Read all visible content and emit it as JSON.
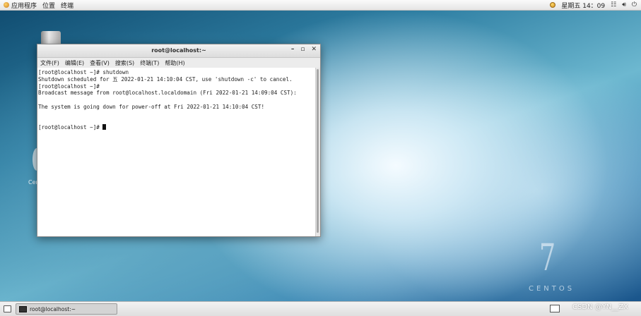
{
  "top_panel": {
    "apps_menu": "应用程序",
    "places_menu": "位置",
    "terminal_menu": "终端",
    "clock": "星期五 14：09",
    "network_icon": "network-icon",
    "volume_icon": "volume-icon",
    "power_icon": "power-icon"
  },
  "desktop": {
    "disc_label": "Cen",
    "logo_number": "7",
    "logo_text": "CENTOS"
  },
  "window": {
    "title": "root@localhost:~",
    "minimize": "–",
    "maximize": "▫",
    "close": "✕",
    "menus": [
      "文件(F)",
      "编辑(E)",
      "查看(V)",
      "搜索(S)",
      "终端(T)",
      "帮助(H)"
    ],
    "terminal_lines": [
      "[root@localhost ~]# shutdown",
      "Shutdown scheduled for 五 2022-01-21 14:10:04 CST, use 'shutdown -c' to cancel.",
      "[root@localhost ~]#",
      "Broadcast message from root@localhost.localdomain (Fri 2022-01-21 14:09:04 CST):",
      "",
      "The system is going down for power-off at Fri 2022-01-21 14:10:04 CST!",
      "",
      "",
      "[root@localhost ~]# "
    ]
  },
  "bottom_panel": {
    "task_label": "root@localhost:~",
    "watermark": "CSDN @YN__ZX"
  }
}
